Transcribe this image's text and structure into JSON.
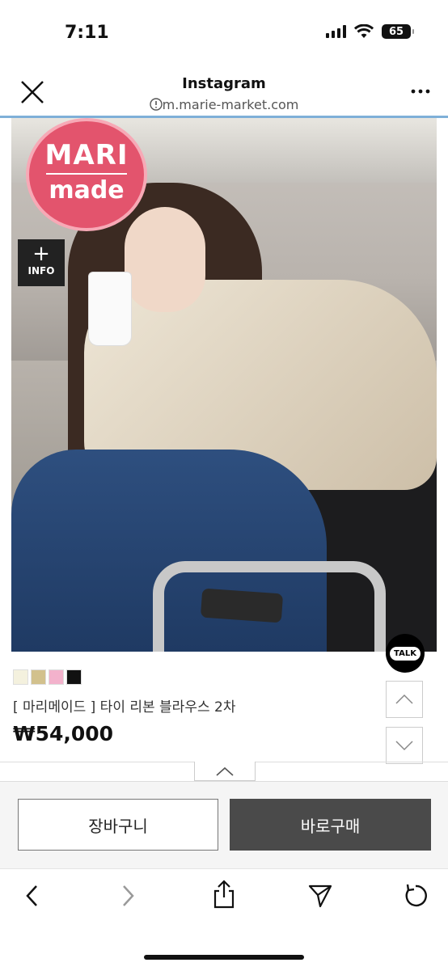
{
  "status": {
    "time": "7:11",
    "battery": "65"
  },
  "browser": {
    "title": "Instagram",
    "url": "m.marie-market.com"
  },
  "product": {
    "brand_line1": "MARI",
    "brand_line2": "made",
    "info_label": "INFO",
    "swatch_colors": [
      "#f4f1de",
      "#d2c18d",
      "#f3b2cc",
      "#111111"
    ],
    "name": "[ 마리메이드 ] 타이 리본 블라우스 2차",
    "price": "₩54,000"
  },
  "talk_label": "TALK",
  "actions": {
    "cart_label": "장바구니",
    "buy_label": "바로구매"
  }
}
